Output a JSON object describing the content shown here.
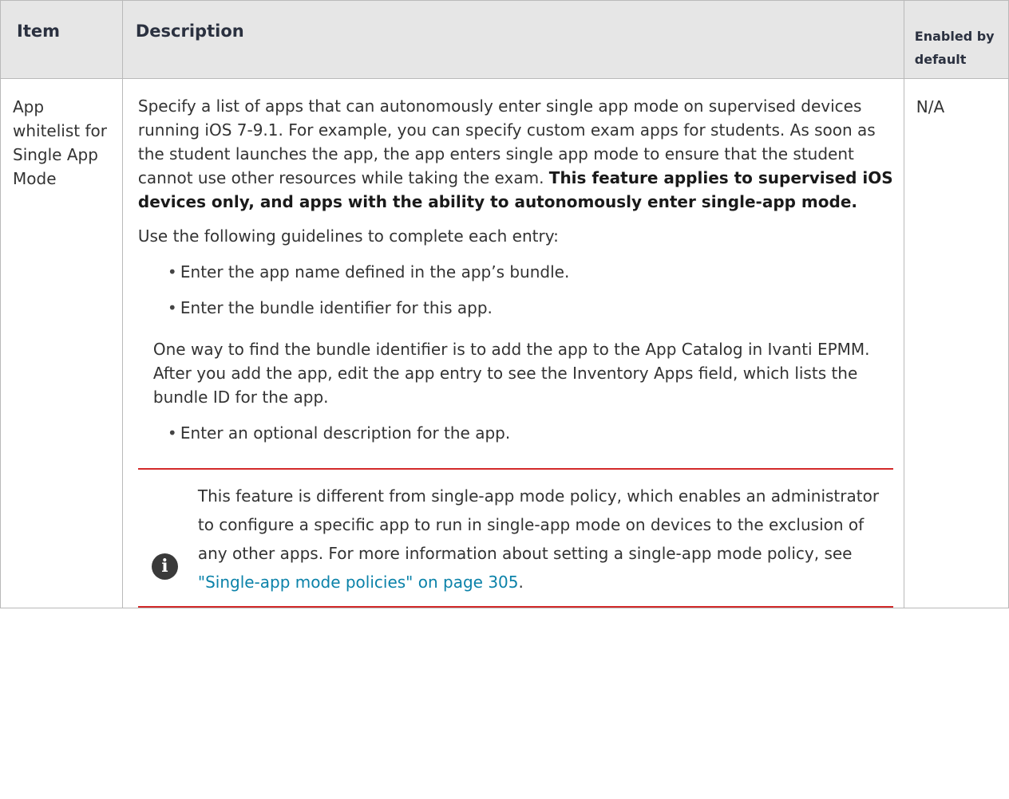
{
  "table": {
    "headers": {
      "item": "Item",
      "description": "Description",
      "enabled_by_default": "Enabled by default"
    },
    "row": {
      "item": "App whitelist for Single App Mode",
      "description_intro": "Specify a list of apps that can autonomously enter single app mode on supervised devices running iOS 7-9.1. For example, you can specify custom exam apps for students. As soon as the student launches the app, the app enters single app mode to ensure that the student cannot use other resources while taking the exam.",
      "description_bold": "This feature applies to supervised iOS devices only, and apps with the ability to autonomously enter single-app mode.",
      "guidelines_intro": "Use the following guidelines to complete each entry:",
      "bullets": [
        "Enter the app name defined in the app’s bundle.",
        "Enter the bundle identifier for this app."
      ],
      "bundle_note": "One way to find the bundle identifier is to add the app to the App Catalog in Ivanti EPMM. After you add the app, edit the app entry to see the Inventory Apps field, which lists the bundle ID for the app.",
      "bullet_last": "Enter an optional description for the app.",
      "note_text": "This feature is different from single-app mode policy, which enables an administrator to configure a specific app to run in single-app mode on devices to the exclusion of any other apps. For more information about setting a single-app mode policy, see ",
      "note_link": "\"Single-app mode policies\" on page 305",
      "note_end": ".",
      "enabled_by_default": "N/A"
    }
  },
  "icons": {
    "note_icon": "info-icon",
    "note_icon_glyph": "i"
  },
  "colors": {
    "header_bg": "#e6e6e6",
    "note_rule": "#d32a2a",
    "link": "#0b82a9"
  }
}
